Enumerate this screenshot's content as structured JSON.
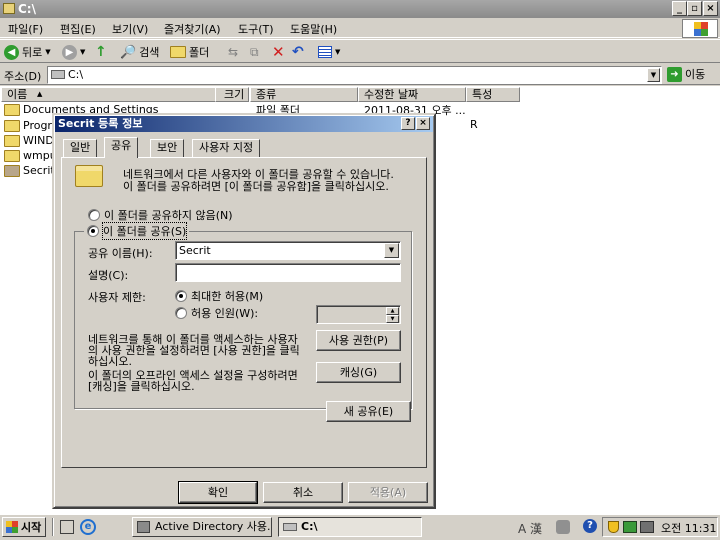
{
  "window": {
    "title": "C:\\"
  },
  "menu": [
    "파일(F)",
    "편집(E)",
    "보기(V)",
    "즐겨찾기(A)",
    "도구(T)",
    "도움말(H)"
  ],
  "toolbar": {
    "back": "뒤로",
    "search": "검색",
    "folders": "폴더"
  },
  "address": {
    "label": "주소(D)",
    "value": "C:\\",
    "go": "이동"
  },
  "columns": [
    "이름",
    "크기",
    "종류",
    "수정한 날짜",
    "특성"
  ],
  "files": [
    {
      "name": "Documents and Settings",
      "type": "파일 폴더",
      "date": "2011-08-31 오후 ..."
    },
    {
      "name": "Progra",
      "attr": "R"
    },
    {
      "name": "WINDO"
    },
    {
      "name": "wmpu"
    },
    {
      "name": "Secrit"
    }
  ],
  "dialog": {
    "title": "Secrit 등록 정보",
    "tabs": [
      "일반",
      "공유",
      "보안",
      "사용자 지정"
    ],
    "intro": [
      "네트워크에서 다른 사용자와 이 폴더를 공유할 수 있습니다.",
      "이 폴더를 공유하려면 [이 폴더를 공유함]을 클릭하십시오."
    ],
    "no_share": "이 폴더를 공유하지 않음(N)",
    "share": "이 폴더를 공유(S)",
    "share_name_label": "공유 이름(H):",
    "share_name_value": "Secrit",
    "desc_label": "설명(C):",
    "desc_value": "",
    "limit_label": "사용자 제한:",
    "max_allowed": "최대한 허용(M)",
    "allow_users": "허용 인원(W):",
    "perm_text": [
      "네트워크를 통해 이 폴더를 액세스하는 사용자",
      "의 사용 권한을 설정하려면 [사용 권한]을 클릭",
      "하십시오."
    ],
    "perm_button": "사용 권한(P)",
    "cache_text": [
      "이 폴더의 오프라인 액세스 설정을 구성하려면",
      "[캐싱]을 클릭하십시오."
    ],
    "cache_button": "캐싱(G)",
    "new_share": "새 공유(E)",
    "ok": "확인",
    "cancel": "취소",
    "apply": "적용(A)"
  },
  "taskbar": {
    "start": "시작",
    "items": [
      "Active Directory 사용...",
      "C:\\"
    ],
    "clock": "오전 11:31",
    "ime": "A 漢"
  }
}
